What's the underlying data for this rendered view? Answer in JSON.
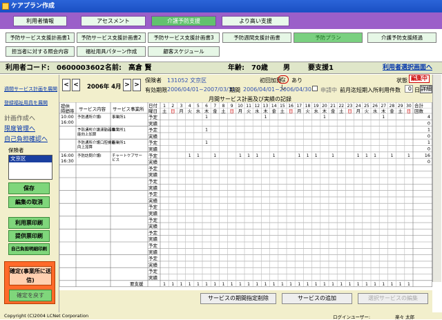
{
  "window": {
    "title": "ケアプラン作成"
  },
  "main_tabs": [
    {
      "label": "利用者情報",
      "active": false
    },
    {
      "label": "アセスメント",
      "active": false
    },
    {
      "label": "介護予防支援",
      "active": true
    },
    {
      "label": "より高い支援",
      "active": false
    }
  ],
  "sub_tabs_row1": [
    {
      "label": "予防サービス支援計画書1"
    },
    {
      "label": "予防サービス支援計画書2"
    },
    {
      "label": "予防サービス支援計画書3"
    },
    {
      "label": "予防週間支援計画書"
    },
    {
      "label": "予防プラン",
      "active": true
    },
    {
      "label": "介護予防支援経過"
    }
  ],
  "sub_tabs_row2": [
    {
      "label": "担当者に対する照会内容"
    },
    {
      "label": "福祉用具パターン作成"
    },
    {
      "label": "顧客スケジュール"
    }
  ],
  "info": {
    "user_code_label": "利用者コード:",
    "user_code": "0600003602",
    "name_label": "名前:",
    "name": "高倉 賢",
    "age_label": "年齢:",
    "age": "70歳",
    "gender": "男",
    "care_level": "要支援1",
    "select_link": "利用者選択画面へ"
  },
  "sidebar": {
    "link1": "週間サービス計画を展開",
    "link2": "登録福祉用具を展開",
    "link3": "計画作成へ",
    "link4": "限度管理へ",
    "link5": "自己負担確認へ",
    "insurer_label": "保険者",
    "insurer_value": "文京区",
    "save": "保存",
    "cancel": "編集の取消",
    "print_usage": "利用票印刷",
    "print_provide": "提供票印刷",
    "print_self": "自己負担明細印刷",
    "confirm": "確定(事業所に送信)",
    "revert": "確定を戻す"
  },
  "plan": {
    "prev": "<",
    "prev2": "<",
    "month": "2006年 4月",
    "next": ">",
    "next2": ">",
    "insurer_label": "保険者",
    "insurer": "131052  文京区",
    "valid_label": "有効期限",
    "valid": "2006/04/01~2007/03/31",
    "period_label": "期間",
    "period": "2006/04/01~2006/04/30",
    "first_add_label": "初回加算",
    "first_add_none": "なし",
    "first_add_yes": "あり",
    "applying": "申請中",
    "prev_month_label": "前月迄短期入所利用件数",
    "prev_month_value": "0",
    "day_unit": "日",
    "detail": "詳細",
    "status_label": "状態",
    "status": "編集中",
    "grid_title": "月間サービス計画及び実績の記録"
  },
  "grid": {
    "headers": [
      "提供時間帯",
      "サービス内容",
      "サービス事業所",
      "日付",
      "合計回数"
    ],
    "day_label": "曜日",
    "days": [
      "1",
      "2",
      "3",
      "4",
      "5",
      "6",
      "7",
      "8",
      "9",
      "10",
      "11",
      "12",
      "13",
      "14",
      "15",
      "16",
      "17",
      "18",
      "19",
      "20",
      "21",
      "22",
      "23",
      "24",
      "25",
      "26",
      "27",
      "28",
      "29",
      "30"
    ],
    "weekdays": [
      "土",
      "日",
      "月",
      "火",
      "水",
      "木",
      "金",
      "土",
      "日",
      "月",
      "火",
      "水",
      "木",
      "金",
      "土",
      "日",
      "月",
      "火",
      "水",
      "木",
      "金",
      "土",
      "日",
      "月",
      "火",
      "水",
      "木",
      "金",
      "土",
      "日"
    ],
    "plan_label": "予定",
    "actual_label": "実績",
    "rows": [
      {
        "time": "10:00\n16:00",
        "service": "予防通所介護Ⅰ",
        "provider": "事業所1",
        "plan_days": [
          6,
          13,
          20,
          27
        ],
        "total_plan": "4",
        "total_actual": "0"
      },
      {
        "time": "",
        "service": "予防通所介護運動器機能向上加算",
        "provider": "事業所1",
        "plan_days": [
          6
        ],
        "total_plan": "1",
        "total_actual": "0"
      },
      {
        "time": "",
        "service": "予防通所介護口腔機能向上加算",
        "provider": "事業所1",
        "plan_days": [
          6
        ],
        "total_plan": "1",
        "total_actual": "0"
      },
      {
        "time": "16:00\n16:30",
        "service": "予防訪問介護Ⅰ",
        "provider": "チャートケアサービス",
        "plan_days": [
          4,
          5,
          7,
          10,
          11,
          12,
          14,
          17,
          18,
          19,
          21,
          24,
          25,
          26,
          28,
          30
        ],
        "total_plan": "16",
        "total_actual": "0"
      }
    ],
    "footer_label": "要支援"
  },
  "buttons": {
    "delete_period": "サービスの期間指定削除",
    "add_service": "サービスの追加",
    "edit_service": "選択サービスの編集"
  },
  "footer": {
    "copyright": "Copyright (C)2004 LCNet Corporation",
    "login_label": "ログインユーザー:",
    "login_user": "楽々 太郎"
  }
}
